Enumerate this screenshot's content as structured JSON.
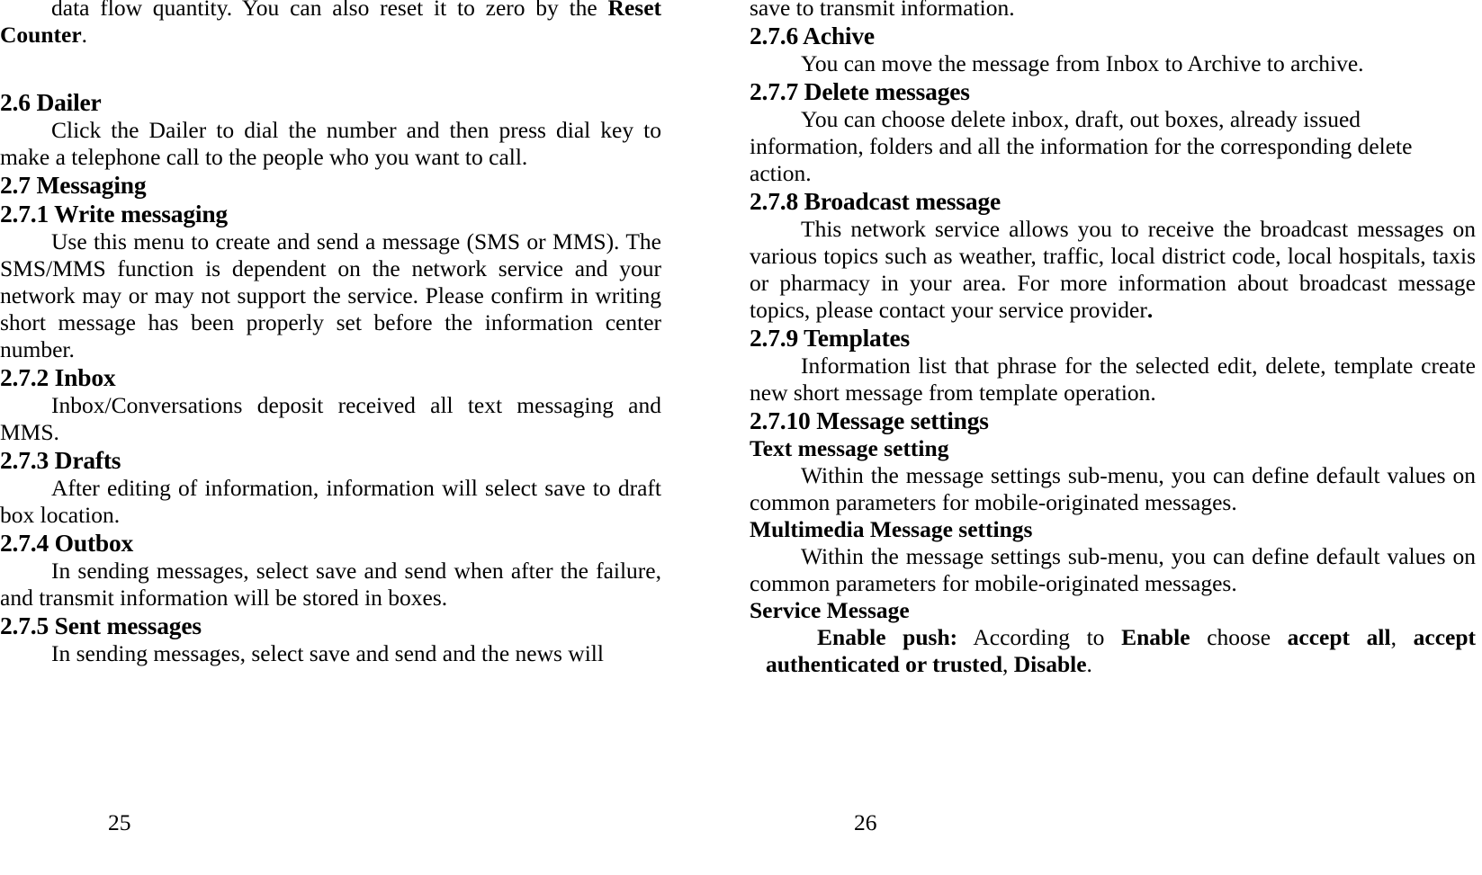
{
  "document": {
    "type": "user-manual-spread",
    "left_page_number": "25",
    "right_page_number": "26"
  },
  "left_page": {
    "continued_paragraph": {
      "text_before_bold": "data flow quantity. You can also reset it to zero by the ",
      "bold_term": "Reset Counter",
      "text_after_bold": "."
    },
    "sections": [
      {
        "id": "2.6",
        "heading": "2.6 Dailer",
        "body": "Click the Dailer to dial the number and then press dial key to make a telephone call to the people who you want to call."
      },
      {
        "id": "2.7",
        "heading": "2.7 Messaging",
        "body": ""
      },
      {
        "id": "2.7.1",
        "heading": "2.7.1 Write messaging",
        "body": "Use this menu to create and send a message (SMS or MMS). The SMS/MMS function is dependent on the network service and your network may or may not support the service. Please confirm in writing short message has been properly set before the information center number."
      },
      {
        "id": "2.7.2",
        "heading": "2.7.2 Inbox",
        "body": "Inbox/Conversations deposit received all text messaging and MMS."
      },
      {
        "id": "2.7.3",
        "heading": "2.7.3 Drafts",
        "body": "After editing of information, information will select save to draft box location."
      },
      {
        "id": "2.7.4",
        "heading": "2.7.4 Outbox",
        "body": "In sending messages, select save and send when after the failure, and transmit information will be stored in boxes."
      },
      {
        "id": "2.7.5",
        "heading": "2.7.5 Sent messages",
        "body": "In sending messages, select save and send and the news will"
      }
    ]
  },
  "right_page": {
    "continued_paragraph": {
      "text": "save to transmit information."
    },
    "sections": [
      {
        "id": "2.7.6",
        "heading": "2.7.6 Achive",
        "body": "You can move the message from Inbox to Archive to archive."
      },
      {
        "id": "2.7.7",
        "heading": "2.7.7 Delete messages",
        "body": "You can choose delete inbox, draft, out boxes, already issued information, folders and all the information for the corresponding delete action."
      },
      {
        "id": "2.7.8",
        "heading": "2.7.8 Broadcast message",
        "body_before_bold": "This network service allows you to receive the broadcast messages on various topics such as weather, traffic, local district code, local hospitals, taxis or pharmacy in your area. For more information about broadcast message topics, please contact your service provider",
        "bold_period": "."
      },
      {
        "id": "2.7.9",
        "heading": "2.7.9 Templates",
        "body": "Information list that phrase for the selected edit, delete, template create new short message from template operation."
      },
      {
        "id": "2.7.10",
        "heading": "2.7.10 Message settings",
        "subsections": [
          {
            "subheading": "Text message setting",
            "body": "Within the message settings sub-menu, you can define default values on common parameters for mobile-originated messages."
          },
          {
            "subheading": "Multimedia Message settings",
            "body": "Within the message settings sub-menu, you can define default values on common parameters for mobile-originated messages."
          },
          {
            "subheading": "Service Message",
            "enable_push": {
              "label": "Enable push:",
              "text1": " According to ",
              "bold1": "Enable",
              "text2": " choose ",
              "bold2": "accept all",
              "text3": ", ",
              "bold3": "accept authenticated or trusted",
              "text4": ", ",
              "bold4": "Disable",
              "text5": "."
            }
          }
        ]
      }
    ]
  }
}
